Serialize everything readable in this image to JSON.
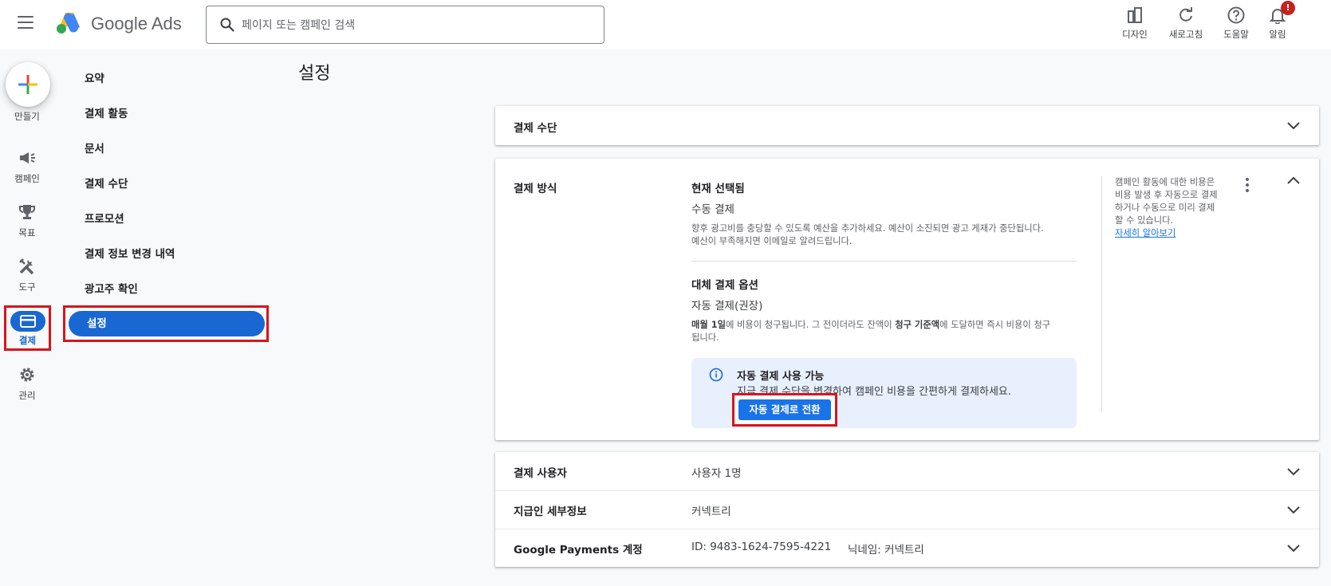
{
  "header": {
    "brand": "Google Ads",
    "search_placeholder": "페이지 또는 캠페인 검색",
    "actions": [
      {
        "label": "디자인",
        "icon": "design-icon"
      },
      {
        "label": "새로고침",
        "icon": "refresh-icon"
      },
      {
        "label": "도움말",
        "icon": "help-icon"
      },
      {
        "label": "알림",
        "icon": "bell-icon",
        "badge": "!"
      }
    ]
  },
  "rail": {
    "create_label": "만들기",
    "items": [
      {
        "label": "캠페인",
        "icon": "megaphone-icon"
      },
      {
        "label": "목표",
        "icon": "trophy-icon"
      },
      {
        "label": "도구",
        "icon": "tools-icon"
      },
      {
        "label": "결제",
        "icon": "credit-card-icon",
        "active": true
      },
      {
        "label": "관리",
        "icon": "gear-icon"
      }
    ]
  },
  "nav": {
    "items": [
      "요약",
      "결제 활동",
      "문서",
      "결제 수단",
      "프로모션",
      "결제 정보 변경 내역",
      "광고주 확인"
    ],
    "active": "설정"
  },
  "page_title": "설정",
  "payment_instrument": {
    "label": "결제 수단"
  },
  "payment_method": {
    "label": "결제 방식",
    "current_heading": "현재 선택됨",
    "current_value": "수동 결제",
    "current_desc_1": "향후 광고비를 충당할 수 있도록 예산을 추가하세요. 예산이 소진되면 광고 게재가 중단됩니다.",
    "current_desc_2": "예산이 부족해지면 이메일로 알려드립니다.",
    "alt_heading": "대체 결제 옵션",
    "alt_value": "자동 결제(권장)",
    "alt_desc_b1": "매월 1일",
    "alt_desc_t1": "에 비용이 청구됩니다. 그 전이더라도 잔액이",
    "alt_desc_b2": "청구 기준액",
    "alt_desc_t2": "에 도달하면 즉시 비용이 청구",
    "alt_desc_t3": "됩니다.",
    "info_title": "자동 결제 사용 가능",
    "info_desc": "지금 결제 수단을 변경하여 캠페인 비용을 간편하게 결제하세요.",
    "switch_button": "자동 결제로 전환",
    "help_1": "캠페인 활동에 대한 비용은",
    "help_2": "비용 발생 후 자동으로 결제",
    "help_3": "하거나 수동으로 미리 결제",
    "help_4": "할 수 있습니다.",
    "help_link": "자세히 알아보기"
  },
  "rows": [
    {
      "label": "결제 사용자",
      "value": "사용자 1명"
    },
    {
      "label": "지급인 세부정보",
      "value": "커넥트리"
    },
    {
      "label": "Google Payments 계정",
      "value": "ID: 9483-1624-7595-4221",
      "value2": "닉네임: 커넥트리"
    }
  ]
}
